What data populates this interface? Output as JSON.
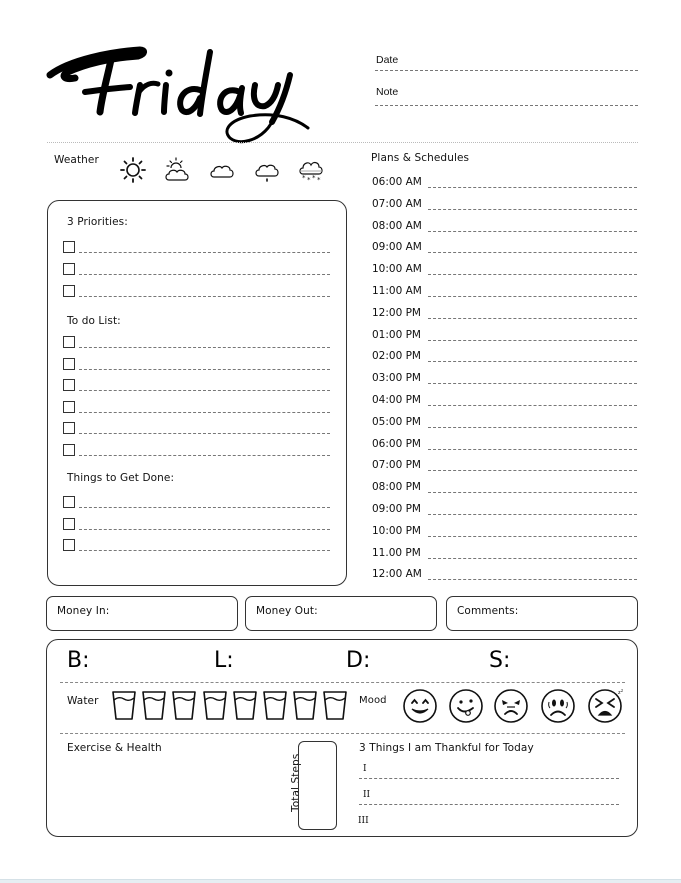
{
  "header": {
    "title": "Friday",
    "date_label": "Date",
    "note_label": "Note"
  },
  "weather": {
    "label": "Weather",
    "icons": [
      "sun-icon",
      "partly-cloudy-icon",
      "cloud-icon",
      "rain-icon",
      "snow-icon"
    ]
  },
  "left_panel": {
    "priorities": {
      "label": "3 Priorities:",
      "count": 3
    },
    "todo": {
      "label": "To do List:",
      "count": 6
    },
    "things": {
      "label": "Things to Get Done:",
      "count": 3
    }
  },
  "schedule": {
    "label": "Plans & Schedules",
    "times": [
      "06:00 AM",
      "07:00 AM",
      "08:00 AM",
      "09:00 AM",
      "10:00 AM",
      "11:00 AM",
      "12:00 PM",
      "01:00 PM",
      "02:00 PM",
      "03:00 PM",
      "04:00 PM",
      "05:00 PM",
      "06:00 PM",
      "07:00 PM",
      "08:00 PM",
      "09:00 PM",
      "10:00 PM",
      "11.00 PM",
      "12:00 AM"
    ]
  },
  "money": {
    "in_label": "Money In:",
    "out_label": "Money Out:",
    "comments_label": "Comments:"
  },
  "meals": {
    "breakfast": "B:",
    "lunch": "L:",
    "dinner": "D:",
    "snack": "S:"
  },
  "water": {
    "label": "Water",
    "glasses": 8
  },
  "mood": {
    "label": "Mood",
    "faces": [
      "happy-face-icon",
      "playful-face-icon",
      "angry-face-icon",
      "sad-face-icon",
      "tired-face-icon"
    ]
  },
  "exercise": {
    "label": "Exercise & Health"
  },
  "steps": {
    "label": "Total Steps"
  },
  "thankful": {
    "label": "3 Things I am Thankful for Today",
    "items": [
      "I",
      "II",
      "III"
    ]
  }
}
